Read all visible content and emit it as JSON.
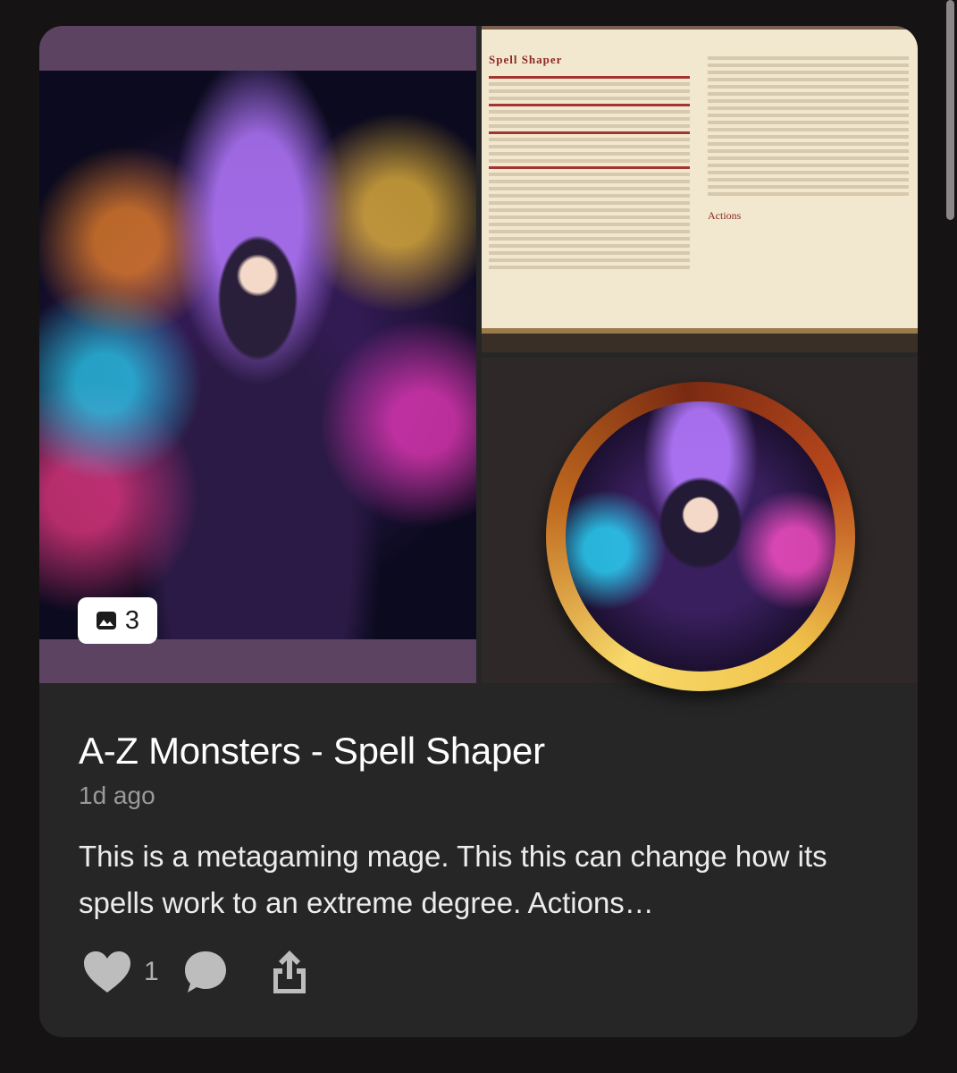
{
  "post": {
    "title": "A-Z Monsters - Spell Shaper",
    "time": "1d ago",
    "description": "This is a metagaming mage. This this can change how its spells work to an extreme degree. Actions…",
    "image_count": "3",
    "like_count": "1"
  },
  "gallery": {
    "images": [
      {
        "label": "main-art-image"
      },
      {
        "label": "stat-block-image",
        "heading": "Spell Shaper",
        "section": "Actions"
      },
      {
        "label": "token-image"
      }
    ]
  },
  "icons": {
    "image_count": "image-icon",
    "like": "heart-icon",
    "comment": "comment-icon",
    "share": "share-icon"
  },
  "colors": {
    "background": "#161314",
    "card": "#262626",
    "title": "#ffffff",
    "muted": "#9a9a9a",
    "icon": "#bdbdbd"
  }
}
